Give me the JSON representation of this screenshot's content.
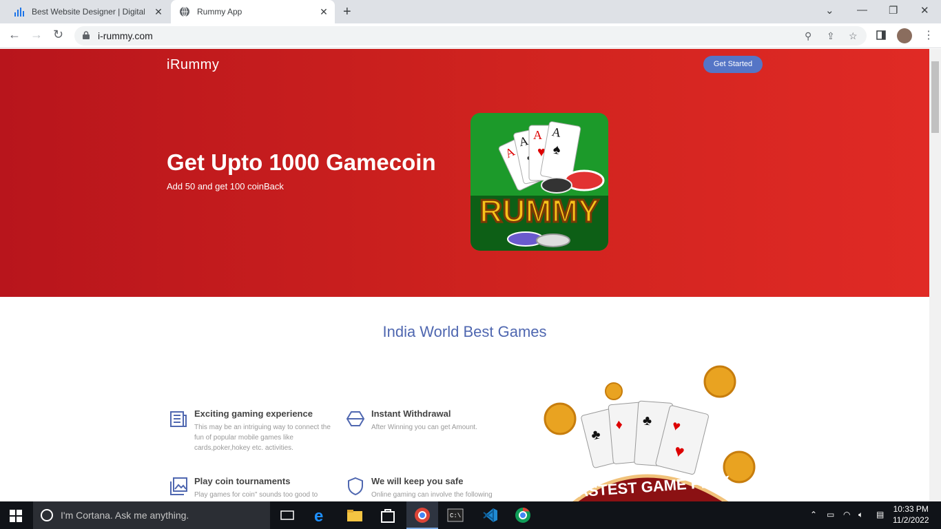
{
  "browser": {
    "tabs": [
      {
        "title": "Best Website Designer | Digital m",
        "icon": "bar-chart-icon"
      },
      {
        "title": "Rummy App",
        "icon": "globe-icon"
      }
    ],
    "url": "i-rummy.com"
  },
  "page": {
    "brand": "iRummy",
    "cta": "Get Started",
    "hero": {
      "title": "Get Upto 1000 Gamecoin",
      "subtitle": "Add 50 and get 100 coinBack",
      "image_text": "RUMMY"
    },
    "section_title": "India World Best Games",
    "features": [
      {
        "title": "Exciting gaming experience",
        "desc": "This may be an intriguing way to connect the fun of popular mobile games like cards,poker,hokey etc. activities.",
        "icon": "newspaper-icon"
      },
      {
        "title": "Instant Withdrawal",
        "desc": "After Winning you can get Amount.",
        "icon": "cube-icon"
      },
      {
        "title": "Play coin tournaments",
        "desc": "Play games for coin\" sounds too good to",
        "icon": "images-icon"
      },
      {
        "title": "We will keep you safe",
        "desc": "Online gaming can involve the following",
        "icon": "shield-icon"
      }
    ],
    "promo_banner": "FASTEST GAME PLAY"
  },
  "taskbar": {
    "search_placeholder": "I'm Cortana. Ask me anything.",
    "time": "10:33 PM",
    "date": "11/2/2022"
  },
  "colors": {
    "hero_red": "#c81d1f",
    "accent_blue": "#5575c6",
    "section_title": "#4f67b0"
  }
}
